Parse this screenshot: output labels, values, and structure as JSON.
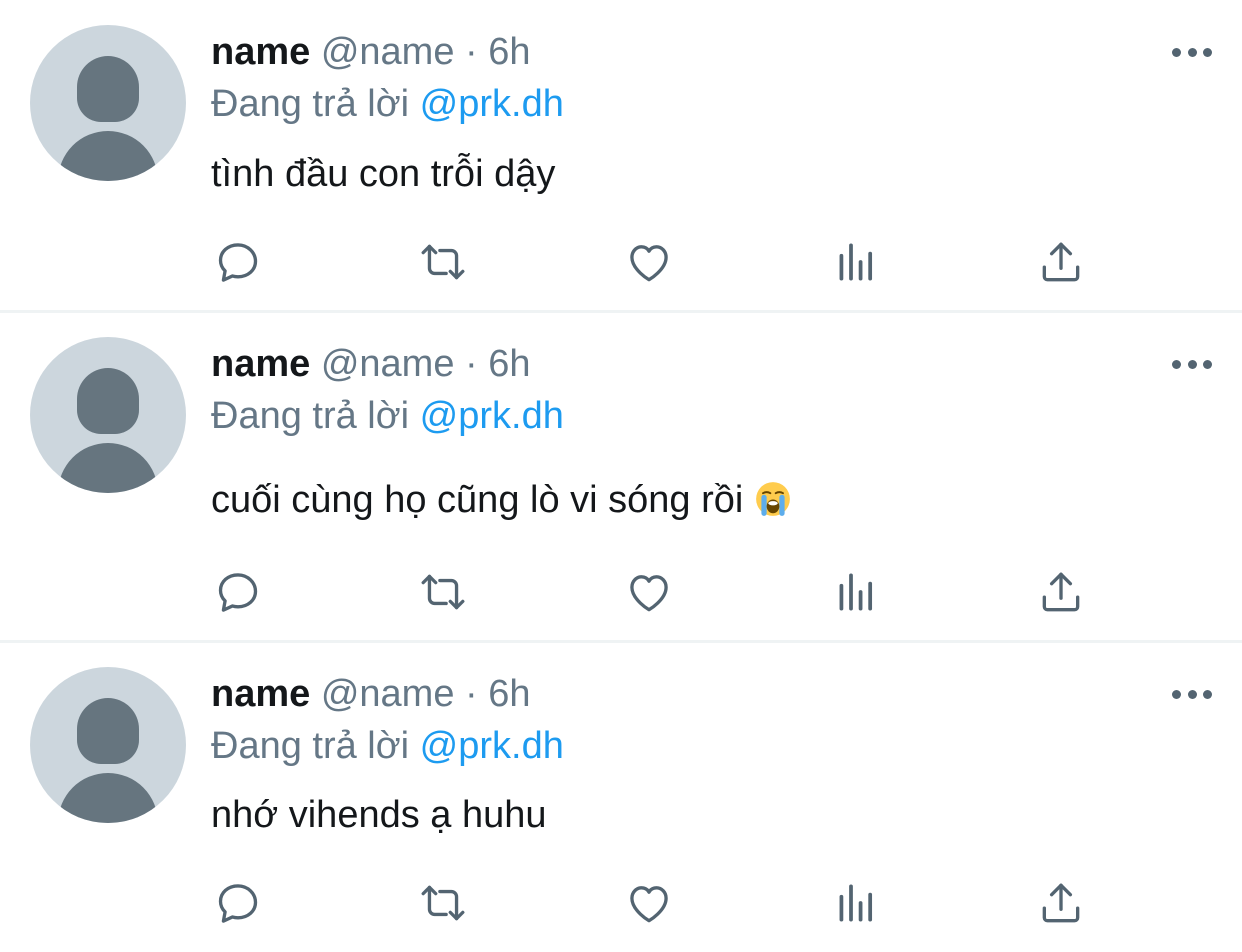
{
  "tweets": [
    {
      "display_name": "name",
      "handle": "@name",
      "separator": "·",
      "time": "6h",
      "reply_prefix": "Đang trả lời",
      "reply_to": "@prk.dh",
      "text": "tình đầu con trỗi dậy",
      "emoji": ""
    },
    {
      "display_name": "name",
      "handle": "@name",
      "separator": "·",
      "time": "6h",
      "reply_prefix": "Đang trả lời",
      "reply_to": "@prk.dh",
      "text": "cuối cùng họ cũng lò vi sóng rồi",
      "emoji": "😭"
    },
    {
      "display_name": "name",
      "handle": "@name",
      "separator": "·",
      "time": "6h",
      "reply_prefix": "Đang trả lời",
      "reply_to": "@prk.dh",
      "text": "nhớ vihends ạ huhu",
      "emoji": ""
    }
  ],
  "actions": [
    "reply-icon",
    "retweet-icon",
    "like-icon",
    "views-icon",
    "share-icon"
  ],
  "colors": {
    "icon": "#536471",
    "link": "#1d9bf0",
    "muted": "#657786",
    "avatar_bg": "#ccd6dd",
    "avatar_fg": "#66757f",
    "divider": "#eff3f4"
  }
}
